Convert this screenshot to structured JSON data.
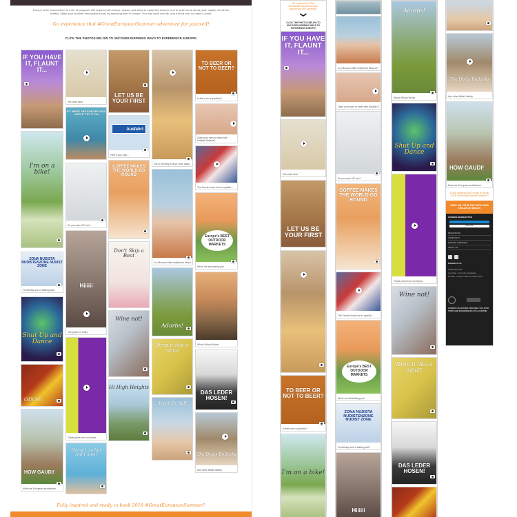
{
  "desktop": {
    "intro_text": "Europe is the summertime to a life of passport! Get inspired with stories, videos, and ideas to make this summer one to write home about (well, maybe not all the selfies). Make your summer memorable round by spending time in Europe. You only have one life, and a short one, so make it count.",
    "orange_lead": "Go experience that #GreatEuropeanSummer adventure for yourself!",
    "click_lead": "CLICK THE PHOTOS BELOW TO UNCOVER INSPIRING WAYS TO EXPERIENCE EUROPE!",
    "footer_lead": "Fully inspired and ready to book 2018 #GreatEuropeanSummer?"
  },
  "cards": {
    "if_you_have_it": "IF YOU HAVE IT, FLAUNT IT...",
    "beach_cap": "Get outta here!",
    "let_us_be_first": "LET US BE YOUR FIRST",
    "eat_it": "Eat it or leave it!",
    "to_beer": "TO BEER OR NOT TO BEER?",
    "to_beer_cap": "Is that even a question?",
    "boots_text": "IF I WERE THE EUROPE SIZE I MIGHT TRY IT ON",
    "ausfahrt": "Ausfahrt",
    "ausfahrt_cap": "Here's your sign...",
    "eat_cap": "Get in my belly! (Serve more oaks)",
    "open_eyes_cap": "Open your eyes to travel with Notable Dreams?",
    "coffee": "COFFEE MAKES THE WORLD GO ROUND",
    "bike": "I'm on a bike!",
    "vr_cap": "Do you even VR, bro?",
    "french_cap": "The French know how to sparkle...",
    "mule_cap": "Is a Moscow Mule really from Moscow?",
    "markets": "Europe's BEST OUTDOOR MARKETS",
    "markets_cap": "We're not advertising you!",
    "nudist": "ZONA NUDISTA NUDISTENZONE NUDIST ZONE",
    "nudist_cap": "To birthday suit or bathing suit?",
    "hiiiii": "Hiiiiii",
    "dont_skip": "Don't Skip a Beat",
    "adorbs": "Adorbs!",
    "shut_up": "Shut Up and Dance",
    "power_cap": "The power of 'Hello'",
    "wine_not": "Wine not!",
    "drop_squat": "Drop it like a squat",
    "when_cap": "Whoa! Whoa! Whoa!",
    "ouch": "OUCH!",
    "purple_cap": "Travel prints from our faves...",
    "hi_heights": "Hi High Heights",
    "treat_yo": "Treat Yo' Self",
    "das_leder": "DAS LEDER HOSEN!",
    "how_gaudi": "HOW GAUDI!",
    "gaudi_cap": "Must see European architecture",
    "hansel": "Hansel, so hot right now!",
    "dogs": "The Dog's Bollocks",
    "dogs_cap": "And other British hilarity"
  },
  "mobile": {
    "top_lead": "Go experience that #GreatEuropeanSummer adventure for yourself!",
    "click_lead": "CLICK THE PHOTOS BELOW TO UNCOVER INSPIRING WAYS TO EXPERIENCE EUROPE!",
    "chevron": "❯",
    "col4_lead": "Fully inspired and ready to book 2018 #GreatEuropeanSummer?",
    "deal_banner": "SAVE ON YOUR TRIP WITH OUR DEALS ON DEALS",
    "newsletter_title": "COSMOS NEWSLETTER",
    "subscribe_label": "Subscribe",
    "nav": [
      "RESOURCES",
      "COMMUNITY",
      "MANAGE A BOOKING",
      "ABOUT US"
    ],
    "contact_title": "CONTACT US",
    "contact_lines": [
      "1-800-556-5454",
      "Live Chat - Currently unavailable",
      "Monday - Friday 6:00am to 6:00pm MST"
    ],
    "legal": "COSMOS VACATIONS PROVIDES YOU WITH TRIPS AND EXPERIENCES OF A LIFETIME"
  },
  "colors": {
    "orange": "#f08a2a",
    "dark_footer": "#1f1f1f",
    "top_bar": "#3a2e34"
  }
}
